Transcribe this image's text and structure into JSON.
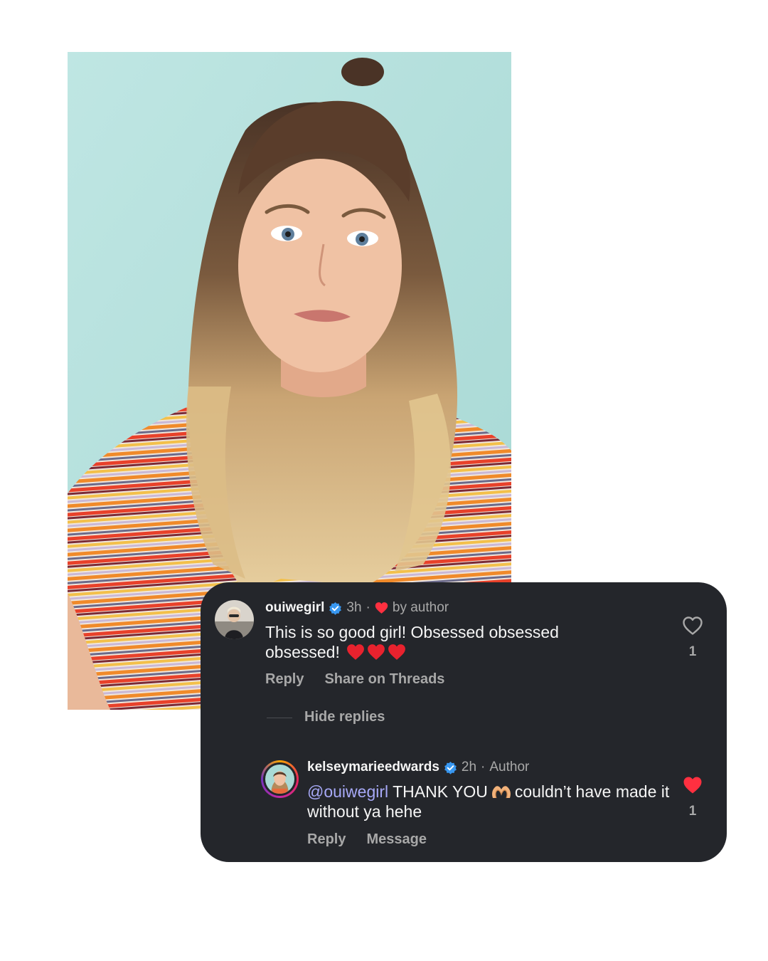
{
  "colors": {
    "card_bg": "#24262b",
    "text_primary": "#f5f5f5",
    "text_secondary": "#a8a8a8",
    "mention": "#a7a9f7",
    "like_red": "#ff3040",
    "verified_blue": "#3897f0",
    "photo_bg": "#b9e2df"
  },
  "comments": [
    {
      "avatar_icon": "user-avatar",
      "username": "ouiwegirl",
      "verified": true,
      "time": "3h",
      "separator": "·",
      "liked_by_author_label": "by author",
      "text": "This is so good girl! Obsessed obsessed obsessed!",
      "emoji": [
        "red-heart",
        "red-heart",
        "red-heart"
      ],
      "actions": [
        "Reply",
        "Share on Threads"
      ],
      "like_icon": "heart-outline-icon",
      "like_count": "1"
    }
  ],
  "hide_replies_label": "Hide replies",
  "reply": {
    "avatar_icon": "user-avatar-story-ring",
    "username": "kelseymarieedwards",
    "verified": true,
    "time": "2h",
    "separator": "·",
    "role": "Author",
    "mention": "@ouiwegirl",
    "text_before_emoji": "THANK YOU",
    "emoji": "heart-hands",
    "text_after_emoji": "couldn’t have made it without ya hehe",
    "actions": [
      "Reply",
      "Message"
    ],
    "like_icon": "heart-filled-icon",
    "like_count": "1"
  }
}
